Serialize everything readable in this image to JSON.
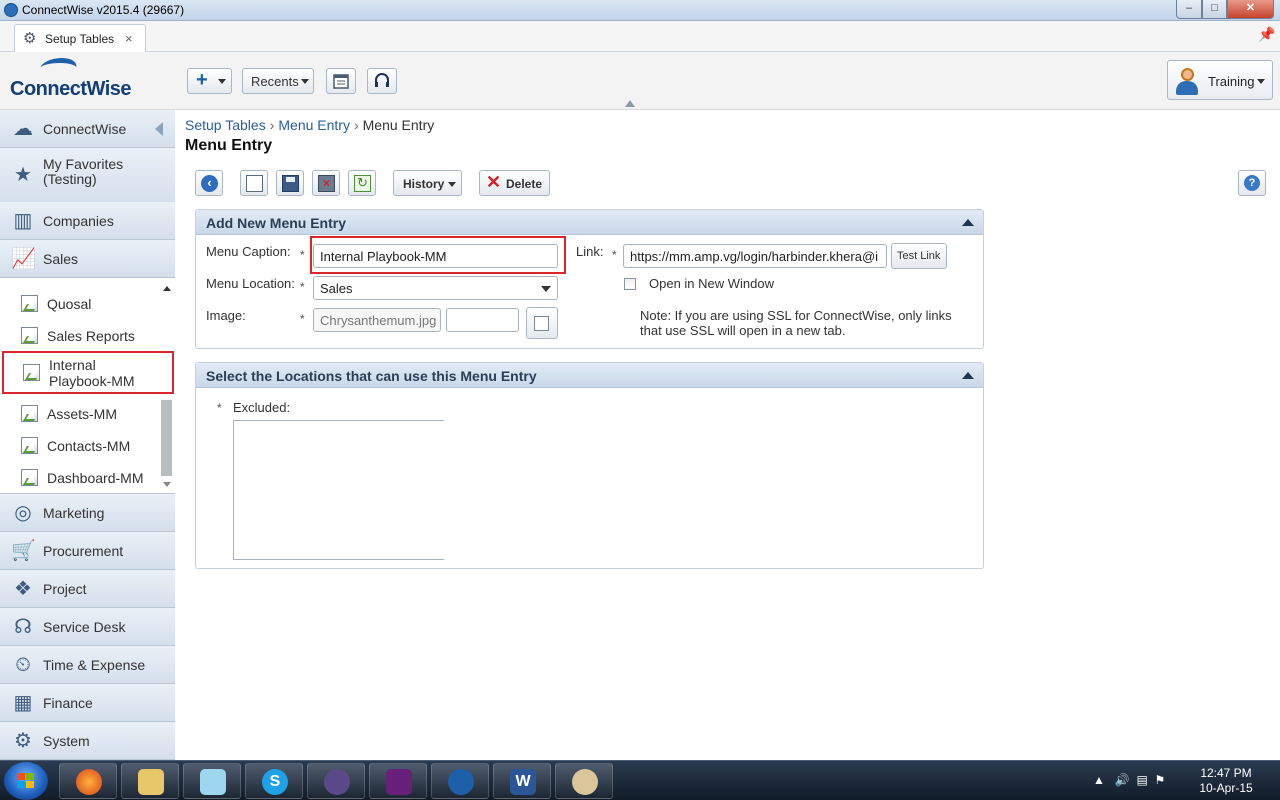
{
  "window": {
    "title": "ConnectWise v2015.4 (29667)",
    "min_glyph": "–",
    "max_glyph": "□",
    "close_glyph": "✕"
  },
  "tabs": [
    {
      "label": "Setup Tables",
      "icon": "gear-icon",
      "close": "×"
    }
  ],
  "header": {
    "logo_text": "ConnectWise",
    "recents_label": "Recents",
    "user_name": "Training"
  },
  "sidebar": {
    "items": [
      {
        "label": "ConnectWise",
        "icon": "connectwise-icon"
      },
      {
        "label": "My Favorites",
        "label2": "(Testing)",
        "icon": "star-icon"
      },
      {
        "label": "Companies",
        "icon": "buildings-icon"
      },
      {
        "label": "Sales",
        "icon": "chart-icon"
      },
      {
        "label": "Marketing",
        "icon": "target-icon"
      },
      {
        "label": "Procurement",
        "icon": "cart-icon"
      },
      {
        "label": "Project",
        "icon": "cubes-icon"
      },
      {
        "label": "Service Desk",
        "icon": "headset-icon"
      },
      {
        "label": "Time & Expense",
        "icon": "clock-icon"
      },
      {
        "label": "Finance",
        "icon": "calculator-icon"
      },
      {
        "label": "System",
        "icon": "gears-icon"
      }
    ],
    "sales_subitems": [
      {
        "label": "Quosal"
      },
      {
        "label": "Sales Reports"
      },
      {
        "label": "Internal",
        "label2": "Playbook-MM",
        "selected": true
      },
      {
        "label": "Assets-MM"
      },
      {
        "label": "Contacts-MM"
      },
      {
        "label": "Dashboard-MM"
      }
    ]
  },
  "breadcrumb": [
    "Setup Tables",
    "Menu Entry",
    "Menu Entry"
  ],
  "page_title": "Menu Entry",
  "toolbar": {
    "history_label": "History",
    "delete_label": "Delete"
  },
  "add_panel": {
    "title": "Add New Menu Entry",
    "required_mark": "*",
    "menu_caption_label": "Menu Caption:",
    "menu_caption_value": "Internal Playbook-MM",
    "menu_location_label": "Menu Location:",
    "menu_location_value": "Sales",
    "image_label": "Image:",
    "image_value": "Chrysanthemum.jpg",
    "link_label": "Link:",
    "link_value": "https://mm.amp.vg/login/harbinder.khera@i",
    "test_link_label": "Test Link",
    "open_new_window_label": "Open in New Window",
    "open_new_window_checked": false,
    "note": "Note: If you are using SSL for ConnectWise, only links that use SSL will open in a new tab."
  },
  "locations_panel": {
    "title": "Select the Locations that can use this Menu Entry",
    "excluded_label": "Excluded:"
  },
  "taskbar": {
    "clock_time": "12:47 PM",
    "clock_date": "10-Apr-15"
  },
  "colors": {
    "highlight": "#d9262c",
    "brand_blue": "#1d5fa8",
    "panel_header": "#c8d7ea"
  }
}
